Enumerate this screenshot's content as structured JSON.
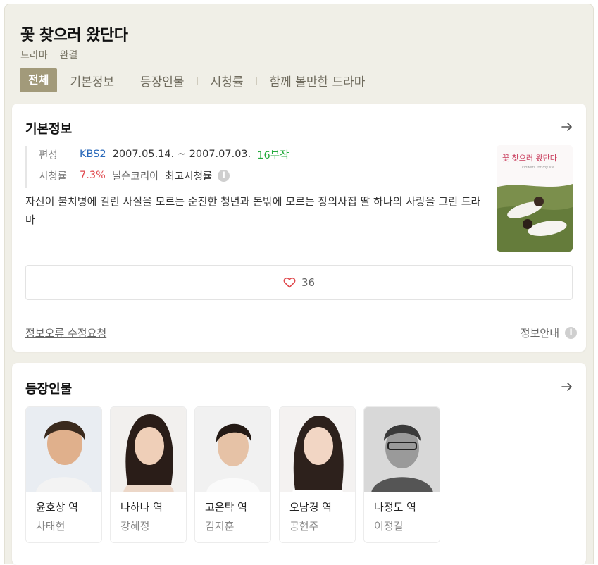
{
  "header": {
    "title": "꽃 찾으러 왔단다",
    "genre": "드라마",
    "status": "완결"
  },
  "tabs": [
    {
      "label": "전체",
      "active": true
    },
    {
      "label": "기본정보",
      "active": false
    },
    {
      "label": "등장인물",
      "active": false
    },
    {
      "label": "시청률",
      "active": false
    },
    {
      "label": "함께 볼만한 드라마",
      "active": false
    }
  ],
  "basic_info": {
    "section_title": "기본정보",
    "broadcast_label": "편성",
    "channel": "KBS2",
    "period": "2007.05.14. ~ 2007.07.03.",
    "episodes": "16부작",
    "rating_label": "시청률",
    "rating_value": "7.3%",
    "rating_source": "닐슨코리아",
    "rating_type": "최고시청률",
    "description": "자신이 불치병에 걸린 사실을 모르는 순진한 청년과 돈밖에 모르는 장의사집 딸 하나의 사랑을 그린 드라마",
    "poster_title": "꽃 찾으러 왔단다",
    "poster_subtitle": "Flowers for my life",
    "like_count": "36",
    "report_link": "정보오류 수정요청",
    "guide_link": "정보안내"
  },
  "cast_section": {
    "section_title": "등장인물",
    "members": [
      {
        "role": "윤호상 역",
        "actor": "차태현"
      },
      {
        "role": "나하나 역",
        "actor": "강혜정"
      },
      {
        "role": "고은탁 역",
        "actor": "김지훈"
      },
      {
        "role": "오남경 역",
        "actor": "공현주"
      },
      {
        "role": "나정도 역",
        "actor": "이정길"
      }
    ]
  },
  "colors": {
    "page_bg": "#f0efe7",
    "active_tab": "#a29a7a",
    "channel_blue": "#2767b9",
    "episodes_green": "#21a93a",
    "rating_red": "#e0484d",
    "heart_red": "#e0484d"
  },
  "icons": {
    "arrow": "arrow-right-icon",
    "info": "info-icon",
    "heart": "heart-outline-icon"
  }
}
